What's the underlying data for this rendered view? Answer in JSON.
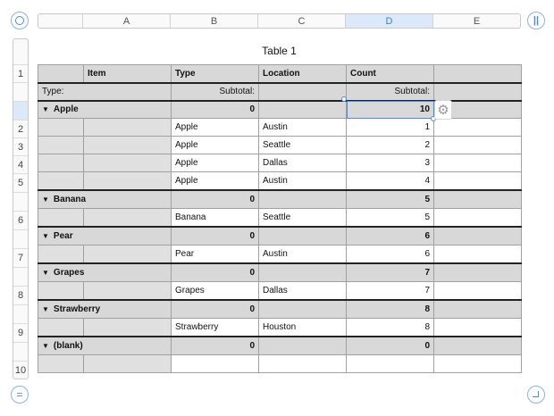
{
  "columns": [
    "A",
    "B",
    "C",
    "D",
    "E"
  ],
  "selected_column": "D",
  "rows_numbers": [
    "1",
    "",
    "2",
    "3",
    "4",
    "5",
    "",
    "6",
    "",
    "7",
    "",
    "8",
    "",
    "9",
    "",
    "10"
  ],
  "title": "Table 1",
  "headers": {
    "a": "",
    "item": "Item",
    "type": "Type",
    "location": "Location",
    "count": "Count"
  },
  "subtotal": {
    "type_label": "Type:",
    "b": "Subtotal:",
    "d": "Subtotal:"
  },
  "groups": [
    {
      "name": "Apple",
      "subtotal_b": "0",
      "subtotal_d": "10",
      "rows": [
        {
          "type": "Apple",
          "location": "Austin",
          "count": "1"
        },
        {
          "type": "Apple",
          "location": "Seattle",
          "count": "2"
        },
        {
          "type": "Apple",
          "location": "Dallas",
          "count": "3"
        },
        {
          "type": "Apple",
          "location": "Austin",
          "count": "4"
        }
      ]
    },
    {
      "name": "Banana",
      "subtotal_b": "0",
      "subtotal_d": "5",
      "rows": [
        {
          "type": "Banana",
          "location": "Seattle",
          "count": "5"
        }
      ]
    },
    {
      "name": "Pear",
      "subtotal_b": "0",
      "subtotal_d": "6",
      "rows": [
        {
          "type": "Pear",
          "location": "Austin",
          "count": "6"
        }
      ]
    },
    {
      "name": "Grapes",
      "subtotal_b": "0",
      "subtotal_d": "7",
      "rows": [
        {
          "type": "Grapes",
          "location": "Dallas",
          "count": "7"
        }
      ]
    },
    {
      "name": "Strawberry",
      "subtotal_b": "0",
      "subtotal_d": "8",
      "rows": [
        {
          "type": "Strawberry",
          "location": "Houston",
          "count": "8"
        }
      ]
    },
    {
      "name": "(blank)",
      "subtotal_b": "0",
      "subtotal_d": "0",
      "rows": [
        {
          "type": "",
          "location": "",
          "count": ""
        }
      ]
    }
  ],
  "icons": {
    "gear": "gear-icon",
    "expand": "triangle-down-icon"
  },
  "accent_color": "#4a8ae0"
}
